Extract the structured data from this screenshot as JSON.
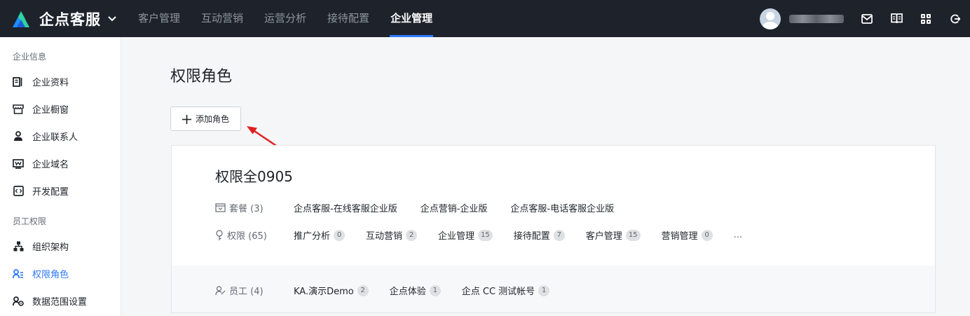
{
  "app": {
    "brand_name": "企点客服",
    "colors": {
      "topbar": "#1d222b",
      "accent": "#2f7bff",
      "annotation_arrow": "#e02020"
    }
  },
  "nav": {
    "items": [
      {
        "label": "客户管理"
      },
      {
        "label": "互动营销"
      },
      {
        "label": "运营分析"
      },
      {
        "label": "接待配置"
      },
      {
        "label": "企业管理",
        "active": true
      }
    ]
  },
  "topbar_icons": [
    "mail-icon",
    "book-icon",
    "apps-grid-icon",
    "logout-icon"
  ],
  "sidebar": {
    "groups": [
      {
        "title": "企业信息",
        "items": [
          {
            "label": "企业资料",
            "icon": "profile-icon"
          },
          {
            "label": "企业橱窗",
            "icon": "storefront-icon"
          },
          {
            "label": "企业联系人",
            "icon": "contact-icon"
          },
          {
            "label": "企业域名",
            "icon": "domain-icon"
          },
          {
            "label": "开发配置",
            "icon": "code-icon"
          }
        ]
      },
      {
        "title": "员工权限",
        "items": [
          {
            "label": "组织架构",
            "icon": "org-tree-icon"
          },
          {
            "label": "权限角色",
            "icon": "role-icon",
            "active": true
          },
          {
            "label": "数据范围设置",
            "icon": "data-scope-icon"
          }
        ]
      }
    ]
  },
  "main": {
    "title": "权限角色",
    "add_button_label": "添加角色",
    "role": {
      "name": "权限全0905",
      "packages_label": "套餐 (3)",
      "packages": [
        "企点客服-在线客服企业版",
        "企点营销-企业版",
        "企点客服-电话客服企业版"
      ],
      "permissions_label": "权限 (65)",
      "permissions": [
        {
          "label": "推广分析",
          "count": "0"
        },
        {
          "label": "互动营销",
          "count": "2"
        },
        {
          "label": "企业管理",
          "count": "15"
        },
        {
          "label": "接待配置",
          "count": "7"
        },
        {
          "label": "客户管理",
          "count": "15"
        },
        {
          "label": "营销管理",
          "count": "0"
        }
      ],
      "permissions_more": "...",
      "staff_label": "员工 (4)",
      "staff": [
        {
          "label": "KA.演示Demo",
          "count": "2"
        },
        {
          "label": "企点体验",
          "count": "1"
        },
        {
          "label": "企点 CC 测试帐号",
          "count": "1"
        }
      ]
    }
  }
}
